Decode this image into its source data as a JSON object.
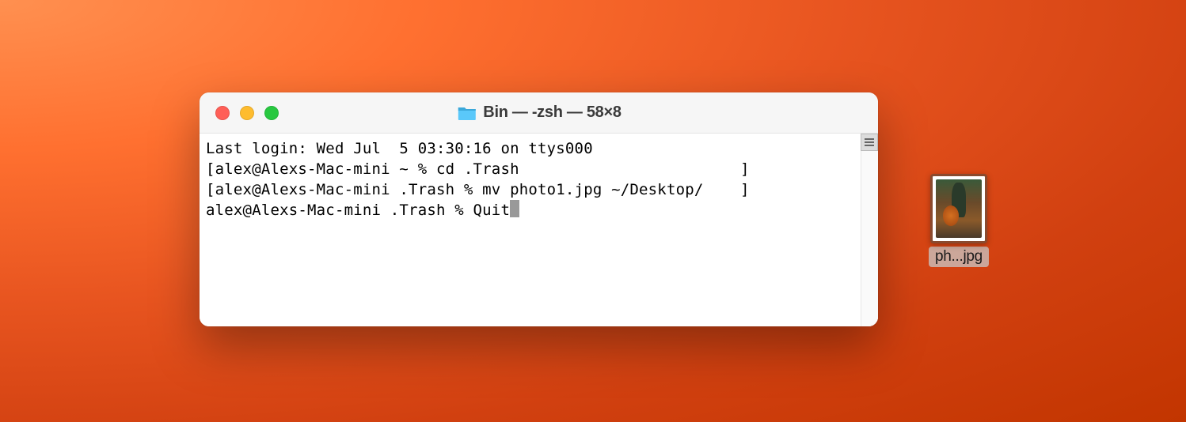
{
  "terminal": {
    "title": "Bin — -zsh — 58×8",
    "lines": {
      "line0": "Last login: Wed Jul  5 03:30:16 on ttys000",
      "line1": "[alex@Alexs-Mac-mini ~ % cd .Trash                        ]",
      "line2": "[alex@Alexs-Mac-mini .Trash % mv photo1.jpg ~/Desktop/    ]",
      "line3_prefix": "alex@Alexs-Mac-mini .Trash % Quit"
    }
  },
  "desktop": {
    "file1": {
      "label": "ph...jpg"
    }
  }
}
